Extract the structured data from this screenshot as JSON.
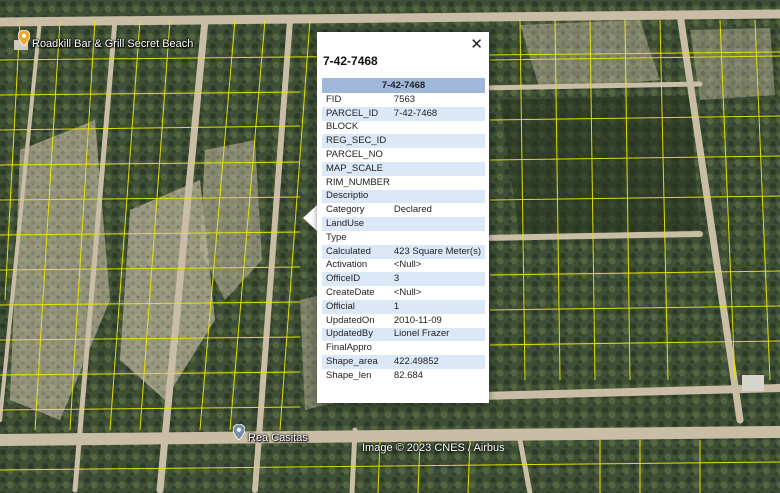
{
  "poi": {
    "bar_label": "Roadkill Bar & Grill Secret Beach",
    "road_label": "Rea Casitas"
  },
  "attribution": "Image © 2023 CNES / Airbus",
  "icons": {
    "poi_pin": "map-pin-icon",
    "road_pin": "map-pin-icon",
    "close": "close-icon"
  },
  "colors": {
    "parcel_lines": "#e8e800",
    "popup_header": "#9fb8d9",
    "popup_row_alt": "#dbe8f7",
    "poi_pin": "#e8a92c",
    "road_pin": "#7a8ea8"
  },
  "popup": {
    "title": "7-42-7468",
    "table_header": "7-42-7468",
    "close_glyph": "✕",
    "rows": [
      {
        "key": "FID",
        "value": "7563"
      },
      {
        "key": "PARCEL_ID",
        "value": "7-42-7468"
      },
      {
        "key": "BLOCK",
        "value": ""
      },
      {
        "key": "REG_SEC_ID",
        "value": ""
      },
      {
        "key": "PARCEL_NO",
        "value": ""
      },
      {
        "key": "MAP_SCALE",
        "value": ""
      },
      {
        "key": "RIM_NUMBER",
        "value": ""
      },
      {
        "key": "Descriptio",
        "value": ""
      },
      {
        "key": "Category",
        "value": "Declared"
      },
      {
        "key": "LandUse",
        "value": ""
      },
      {
        "key": "Type",
        "value": ""
      },
      {
        "key": "Calculated",
        "value": "423 Square Meter(s)"
      },
      {
        "key": "Activation",
        "value": "<Null>"
      },
      {
        "key": "OfficeID",
        "value": "3"
      },
      {
        "key": "CreateDate",
        "value": "<Null>"
      },
      {
        "key": "Official",
        "value": "1"
      },
      {
        "key": "UpdatedOn",
        "value": "2010-11-09"
      },
      {
        "key": "UpdatedBy",
        "value": "Lionel Frazer"
      },
      {
        "key": "FinalAppro",
        "value": ""
      },
      {
        "key": "Shape_area",
        "value": "422.49852"
      },
      {
        "key": "Shape_len",
        "value": "82.684"
      }
    ]
  }
}
